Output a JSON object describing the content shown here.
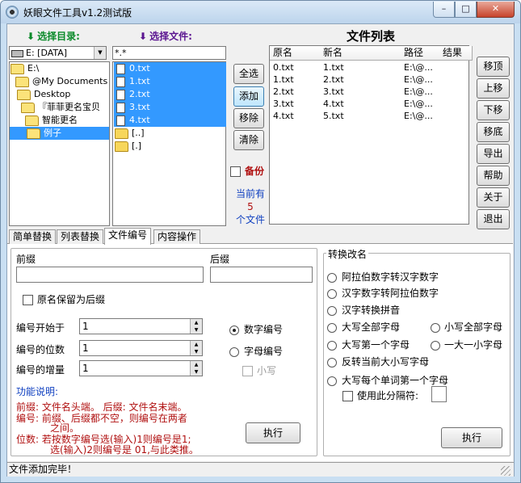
{
  "window": {
    "title": "妖眼文件工具v1.2测试版",
    "minimize": "–",
    "maximize": "□",
    "close": "✕"
  },
  "left": {
    "dir_header": "选择目录:",
    "file_header": "选择文件:",
    "drive": "E: [DATA]",
    "tree": [
      "E:\\",
      "@My Documents",
      "Desktop",
      "『菲菲更名宝贝",
      "智能更名",
      "例子"
    ],
    "filter": "*.*",
    "files": [
      "0.txt",
      "1.txt",
      "2.txt",
      "3.txt",
      "4.txt"
    ],
    "dirs": [
      "[..]",
      "[.]"
    ]
  },
  "middle": {
    "select_all": "全选",
    "add": "添加",
    "remove": "移除",
    "clear": "清除",
    "backup_label": "备份",
    "count_l1": "当前有",
    "count": "5",
    "count_l3": "个文件"
  },
  "list": {
    "title": "文件列表",
    "columns": [
      "原名",
      "新名",
      "路径",
      "结果"
    ],
    "rows": [
      [
        "0.txt",
        "1.txt",
        "E:\\@..."
      ],
      [
        "1.txt",
        "2.txt",
        "E:\\@..."
      ],
      [
        "2.txt",
        "3.txt",
        "E:\\@..."
      ],
      [
        "3.txt",
        "4.txt",
        "E:\\@..."
      ],
      [
        "4.txt",
        "5.txt",
        "E:\\@..."
      ]
    ]
  },
  "right_buttons": [
    "移顶",
    "上移",
    "下移",
    "移底",
    "导出",
    "帮助",
    "关于",
    "退出"
  ],
  "tabs": [
    "简单替换",
    "列表替换",
    "文件编号",
    "内容操作"
  ],
  "numbering": {
    "prefix_label": "前缀",
    "suffix_label": "后缀",
    "keep_orig": "原名保留为后缀",
    "start_label": "编号开始于",
    "start": "1",
    "digits_label": "编号的位数",
    "digits": "1",
    "step_label": "编号的增量",
    "step": "1",
    "num_mode": "数字编号",
    "alpha_mode": "字母编号",
    "lower": "小写",
    "desc_title": "功能说明:",
    "desc1": "前缀: 文件名头端。  后缀: 文件名末端。",
    "desc2a": "编号: 前缀、后缀都不空，则编号在两者",
    "desc2b": "之间。",
    "desc3a": "位数: 若按数字编号选(输入)1则编号是1;",
    "desc3b": "选(输入)2则编号是 01,与此类推。",
    "exec": "执行"
  },
  "convert": {
    "title": "转换改名",
    "opts": [
      "阿拉伯数字转汉字数字",
      "汉字数字转阿拉伯数字",
      "汉字转换拼音",
      "大写全部字母",
      "小写全部字母",
      "大写第一个字母",
      "一大一小字母",
      "反转当前大小写字母",
      "大写每个单词第一个字母"
    ],
    "sep_label": "使用此分隔符:",
    "exec": "执行"
  },
  "status": "文件添加完毕！"
}
